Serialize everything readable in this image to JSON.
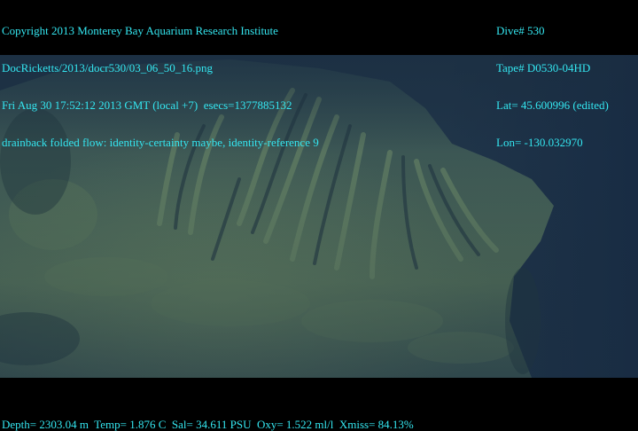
{
  "overlay": {
    "top_left": [
      "Copyright 2013 Monterey Bay Aquarium Research Institute",
      "DocRicketts/2013/docr530/03_06_50_16.png",
      "Fri Aug 30 17:52:12 2013 GMT (local +7)  esecs=1377885132",
      "drainback folded flow: identity-certainty maybe, identity-reference 9"
    ],
    "top_right": [
      "Dive# 530",
      "Tape# D0530-04HD",
      "Lat= 45.600996 (edited)",
      "Lon= -130.032970"
    ],
    "bottom": "Depth= 2303.04 m  Temp= 1.876 C  Sal= 34.611 PSU  Oxy= 1.522 ml/l  Xmiss= 84.13%"
  },
  "colors": {
    "overlay_text": "#34e6f0",
    "water": "#1d3146",
    "rock_light": "#56735a",
    "rock_dark": "#2a3f45"
  }
}
